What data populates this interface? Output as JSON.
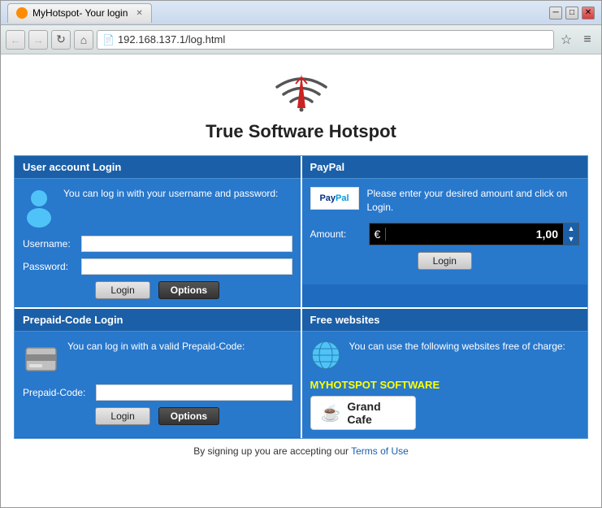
{
  "browser": {
    "tab_label": "MyHotspot- Your login",
    "tab_favicon": "wifi-icon",
    "url": "192.168.137.1/log.html",
    "window_btn_minimize": "─",
    "window_btn_maximize": "□",
    "window_btn_close": "✕"
  },
  "header": {
    "title": "True Software Hotspot"
  },
  "user_panel": {
    "panel_title": "User account Login",
    "description": "You can log in with  your username and password:",
    "username_label": "Username:",
    "password_label": "Password:",
    "username_placeholder": "",
    "password_placeholder": "",
    "login_label": "Login",
    "options_label": "Options"
  },
  "paypal_panel": {
    "panel_title": "PayPal",
    "description": "Please enter your desired amount and click on Login.",
    "amount_label": "Amount:",
    "currency_symbol": "€",
    "amount_value": "1,00",
    "login_label": "Login"
  },
  "prepaid_panel": {
    "panel_title": "Prepaid-Code Login",
    "description": "You can log in with a valid Prepaid-Code:",
    "code_label": "Prepaid-Code:",
    "code_placeholder": "",
    "login_label": "Login",
    "options_label": "Options"
  },
  "free_websites_panel": {
    "panel_title": "Free websites",
    "description": "You can use the  following websites  free of charge:",
    "myhotspot_label": "MYHOTSPOT SOFTWARE",
    "grand_cafe_label": "Grand Cafe"
  },
  "footer": {
    "text": "By signing up you are accepting our ",
    "link_text": "Terms of Use"
  }
}
